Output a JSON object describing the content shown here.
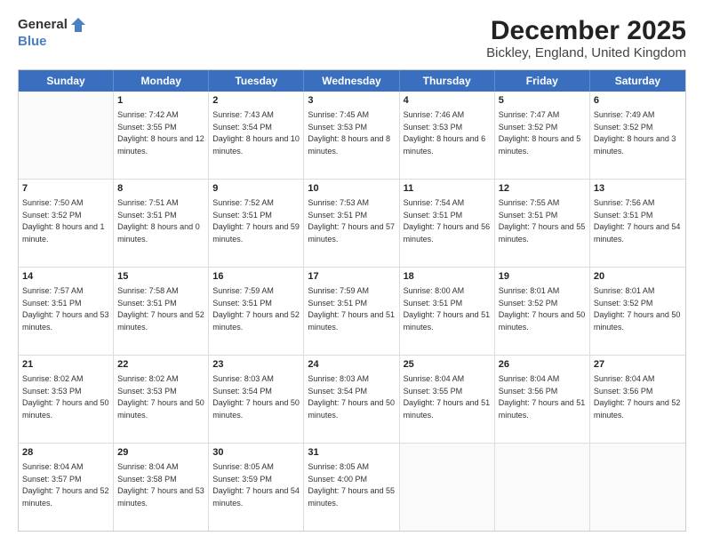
{
  "logo": {
    "general": "General",
    "blue": "Blue"
  },
  "title": "December 2025",
  "subtitle": "Bickley, England, United Kingdom",
  "calendar": {
    "headers": [
      "Sunday",
      "Monday",
      "Tuesday",
      "Wednesday",
      "Thursday",
      "Friday",
      "Saturday"
    ],
    "weeks": [
      [
        {
          "day": "",
          "sunrise": "",
          "sunset": "",
          "daylight": ""
        },
        {
          "day": "1",
          "sunrise": "Sunrise: 7:42 AM",
          "sunset": "Sunset: 3:55 PM",
          "daylight": "Daylight: 8 hours and 12 minutes."
        },
        {
          "day": "2",
          "sunrise": "Sunrise: 7:43 AM",
          "sunset": "Sunset: 3:54 PM",
          "daylight": "Daylight: 8 hours and 10 minutes."
        },
        {
          "day": "3",
          "sunrise": "Sunrise: 7:45 AM",
          "sunset": "Sunset: 3:53 PM",
          "daylight": "Daylight: 8 hours and 8 minutes."
        },
        {
          "day": "4",
          "sunrise": "Sunrise: 7:46 AM",
          "sunset": "Sunset: 3:53 PM",
          "daylight": "Daylight: 8 hours and 6 minutes."
        },
        {
          "day": "5",
          "sunrise": "Sunrise: 7:47 AM",
          "sunset": "Sunset: 3:52 PM",
          "daylight": "Daylight: 8 hours and 5 minutes."
        },
        {
          "day": "6",
          "sunrise": "Sunrise: 7:49 AM",
          "sunset": "Sunset: 3:52 PM",
          "daylight": "Daylight: 8 hours and 3 minutes."
        }
      ],
      [
        {
          "day": "7",
          "sunrise": "Sunrise: 7:50 AM",
          "sunset": "Sunset: 3:52 PM",
          "daylight": "Daylight: 8 hours and 1 minute."
        },
        {
          "day": "8",
          "sunrise": "Sunrise: 7:51 AM",
          "sunset": "Sunset: 3:51 PM",
          "daylight": "Daylight: 8 hours and 0 minutes."
        },
        {
          "day": "9",
          "sunrise": "Sunrise: 7:52 AM",
          "sunset": "Sunset: 3:51 PM",
          "daylight": "Daylight: 7 hours and 59 minutes."
        },
        {
          "day": "10",
          "sunrise": "Sunrise: 7:53 AM",
          "sunset": "Sunset: 3:51 PM",
          "daylight": "Daylight: 7 hours and 57 minutes."
        },
        {
          "day": "11",
          "sunrise": "Sunrise: 7:54 AM",
          "sunset": "Sunset: 3:51 PM",
          "daylight": "Daylight: 7 hours and 56 minutes."
        },
        {
          "day": "12",
          "sunrise": "Sunrise: 7:55 AM",
          "sunset": "Sunset: 3:51 PM",
          "daylight": "Daylight: 7 hours and 55 minutes."
        },
        {
          "day": "13",
          "sunrise": "Sunrise: 7:56 AM",
          "sunset": "Sunset: 3:51 PM",
          "daylight": "Daylight: 7 hours and 54 minutes."
        }
      ],
      [
        {
          "day": "14",
          "sunrise": "Sunrise: 7:57 AM",
          "sunset": "Sunset: 3:51 PM",
          "daylight": "Daylight: 7 hours and 53 minutes."
        },
        {
          "day": "15",
          "sunrise": "Sunrise: 7:58 AM",
          "sunset": "Sunset: 3:51 PM",
          "daylight": "Daylight: 7 hours and 52 minutes."
        },
        {
          "day": "16",
          "sunrise": "Sunrise: 7:59 AM",
          "sunset": "Sunset: 3:51 PM",
          "daylight": "Daylight: 7 hours and 52 minutes."
        },
        {
          "day": "17",
          "sunrise": "Sunrise: 7:59 AM",
          "sunset": "Sunset: 3:51 PM",
          "daylight": "Daylight: 7 hours and 51 minutes."
        },
        {
          "day": "18",
          "sunrise": "Sunrise: 8:00 AM",
          "sunset": "Sunset: 3:51 PM",
          "daylight": "Daylight: 7 hours and 51 minutes."
        },
        {
          "day": "19",
          "sunrise": "Sunrise: 8:01 AM",
          "sunset": "Sunset: 3:52 PM",
          "daylight": "Daylight: 7 hours and 50 minutes."
        },
        {
          "day": "20",
          "sunrise": "Sunrise: 8:01 AM",
          "sunset": "Sunset: 3:52 PM",
          "daylight": "Daylight: 7 hours and 50 minutes."
        }
      ],
      [
        {
          "day": "21",
          "sunrise": "Sunrise: 8:02 AM",
          "sunset": "Sunset: 3:53 PM",
          "daylight": "Daylight: 7 hours and 50 minutes."
        },
        {
          "day": "22",
          "sunrise": "Sunrise: 8:02 AM",
          "sunset": "Sunset: 3:53 PM",
          "daylight": "Daylight: 7 hours and 50 minutes."
        },
        {
          "day": "23",
          "sunrise": "Sunrise: 8:03 AM",
          "sunset": "Sunset: 3:54 PM",
          "daylight": "Daylight: 7 hours and 50 minutes."
        },
        {
          "day": "24",
          "sunrise": "Sunrise: 8:03 AM",
          "sunset": "Sunset: 3:54 PM",
          "daylight": "Daylight: 7 hours and 50 minutes."
        },
        {
          "day": "25",
          "sunrise": "Sunrise: 8:04 AM",
          "sunset": "Sunset: 3:55 PM",
          "daylight": "Daylight: 7 hours and 51 minutes."
        },
        {
          "day": "26",
          "sunrise": "Sunrise: 8:04 AM",
          "sunset": "Sunset: 3:56 PM",
          "daylight": "Daylight: 7 hours and 51 minutes."
        },
        {
          "day": "27",
          "sunrise": "Sunrise: 8:04 AM",
          "sunset": "Sunset: 3:56 PM",
          "daylight": "Daylight: 7 hours and 52 minutes."
        }
      ],
      [
        {
          "day": "28",
          "sunrise": "Sunrise: 8:04 AM",
          "sunset": "Sunset: 3:57 PM",
          "daylight": "Daylight: 7 hours and 52 minutes."
        },
        {
          "day": "29",
          "sunrise": "Sunrise: 8:04 AM",
          "sunset": "Sunset: 3:58 PM",
          "daylight": "Daylight: 7 hours and 53 minutes."
        },
        {
          "day": "30",
          "sunrise": "Sunrise: 8:05 AM",
          "sunset": "Sunset: 3:59 PM",
          "daylight": "Daylight: 7 hours and 54 minutes."
        },
        {
          "day": "31",
          "sunrise": "Sunrise: 8:05 AM",
          "sunset": "Sunset: 4:00 PM",
          "daylight": "Daylight: 7 hours and 55 minutes."
        },
        {
          "day": "",
          "sunrise": "",
          "sunset": "",
          "daylight": ""
        },
        {
          "day": "",
          "sunrise": "",
          "sunset": "",
          "daylight": ""
        },
        {
          "day": "",
          "sunrise": "",
          "sunset": "",
          "daylight": ""
        }
      ]
    ]
  }
}
